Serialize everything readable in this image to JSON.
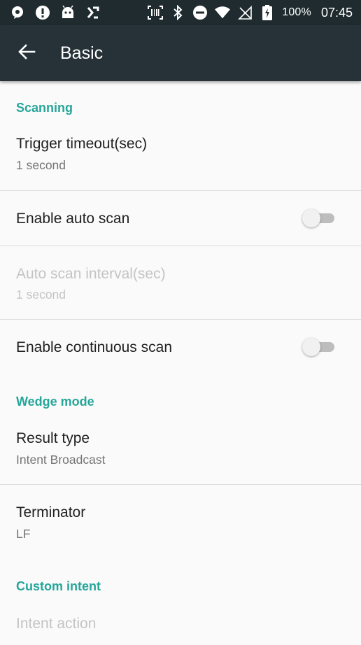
{
  "status_bar": {
    "left_icons": [
      "chat-bubble-icon",
      "alert-icon",
      "android-icon",
      "scan-icon"
    ],
    "right_icons": [
      "barcode-scanner-icon",
      "bluetooth-icon",
      "do-not-disturb-icon",
      "wifi-icon",
      "no-sim-icon",
      "battery-charging-icon"
    ],
    "battery": "100%",
    "time": "07:45"
  },
  "app_bar": {
    "title": "Basic",
    "back_icon": "arrow-back-icon"
  },
  "colors": {
    "app_bar": "#263238",
    "status_bar": "#1f2b2f",
    "accent": "#26a69a",
    "background": "#fafafa"
  },
  "sections": {
    "scanning": {
      "title": "Scanning",
      "trigger_timeout": {
        "title": "Trigger timeout(sec)",
        "summary": "1 second"
      },
      "auto_scan": {
        "title": "Enable auto scan",
        "checked": false
      },
      "auto_scan_interval": {
        "title": "Auto scan interval(sec)",
        "summary": "1 second",
        "enabled": false
      },
      "continuous_scan": {
        "title": "Enable continuous scan",
        "checked": false
      }
    },
    "wedge_mode": {
      "title": "Wedge mode",
      "result_type": {
        "title": "Result type",
        "summary": "Intent Broadcast"
      },
      "terminator": {
        "title": "Terminator",
        "summary": "LF"
      }
    },
    "custom_intent": {
      "title": "Custom intent",
      "intent_action": {
        "title": "Intent action",
        "enabled": false
      }
    }
  }
}
